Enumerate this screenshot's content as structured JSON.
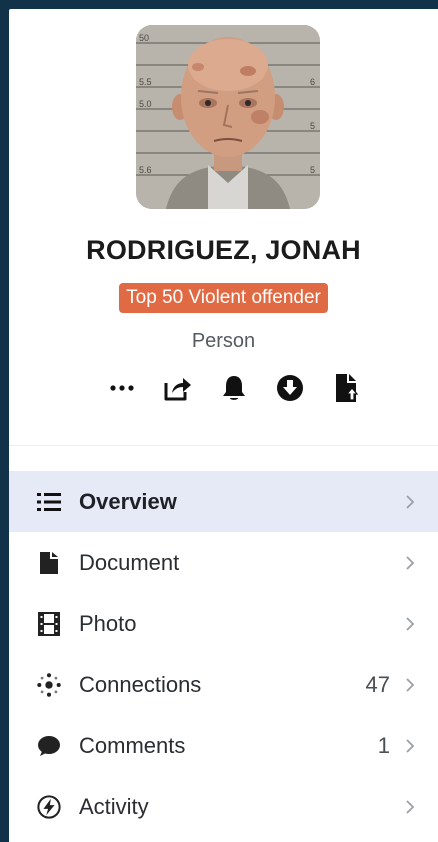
{
  "profile": {
    "name": "RODRIGUEZ, JONAH",
    "badge": "Top 50 Violent offender",
    "type": "Person",
    "mugshot_marks": [
      "50",
      "5.5",
      "5.0",
      "5.6",
      "6",
      "5",
      "5"
    ]
  },
  "colors": {
    "background": "#12324a",
    "badge": "#e06a44",
    "active_row": "#e6eaf7"
  },
  "actions": [
    {
      "icon": "more-dots-icon"
    },
    {
      "icon": "share-icon"
    },
    {
      "icon": "bell-icon"
    },
    {
      "icon": "download-icon"
    },
    {
      "icon": "file-upload-icon"
    }
  ],
  "menu": [
    {
      "label": "Overview",
      "icon": "list-icon",
      "count": "",
      "active": true
    },
    {
      "label": "Document",
      "icon": "document-icon",
      "count": ""
    },
    {
      "label": "Photo",
      "icon": "film-icon",
      "count": ""
    },
    {
      "label": "Connections",
      "icon": "connections-icon",
      "count": "47"
    },
    {
      "label": "Comments",
      "icon": "comment-icon",
      "count": "1"
    },
    {
      "label": "Activity",
      "icon": "activity-icon",
      "count": ""
    }
  ]
}
